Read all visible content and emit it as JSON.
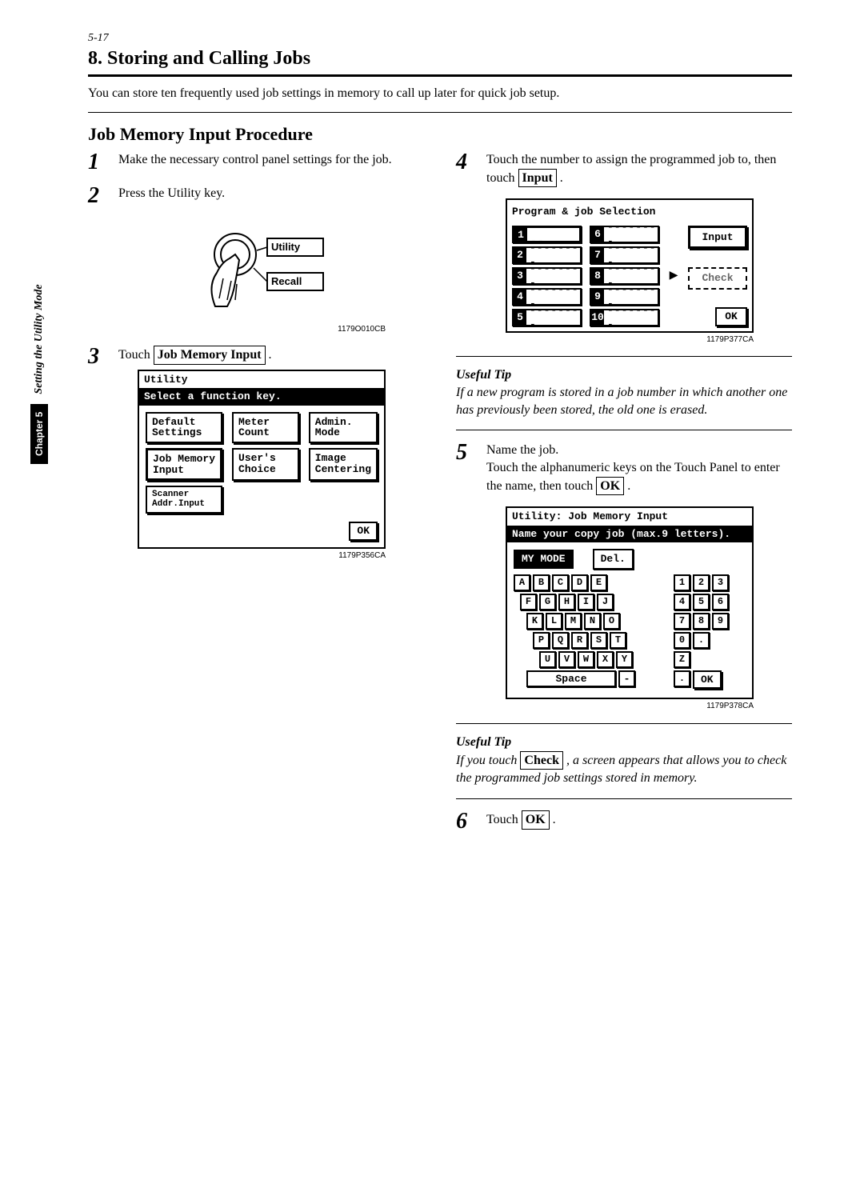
{
  "page_ref": "5-17",
  "section_number": "8.",
  "section_title": "Storing and Calling Jobs",
  "intro": "You can store ten frequently used job settings in memory to call up later for quick job setup.",
  "subsection_title": "Job Memory Input Procedure",
  "side_tab": {
    "chapter_pill": "Chapter 5",
    "label": "Setting the Utility Mode"
  },
  "left": {
    "step1": {
      "num": "1",
      "text": "Make the necessary control panel settings for the job."
    },
    "step2": {
      "num": "2",
      "text": "Press the Utility key.",
      "illus": {
        "utility": "Utility",
        "recall": "Recall"
      },
      "caption": "1179O010CB"
    },
    "step3": {
      "num": "3",
      "text_before": "Touch ",
      "button": "Job Memory Input",
      "text_after": " .",
      "panel": {
        "title": "Utility",
        "subtitle": "Select a function key.",
        "keys": [
          "Default\nSettings",
          "Meter\nCount",
          "Admin.\nMode",
          "Job Memory\nInput",
          "User's\nChoice",
          "Image\nCentering",
          "Scanner\nAddr.Input"
        ],
        "active_index": 3,
        "ok": "OK"
      },
      "caption": "1179P356CA"
    }
  },
  "right": {
    "step4": {
      "num": "4",
      "text_before": "Touch the number to assign the programmed job to, then touch ",
      "button": "Input",
      "text_after": " .",
      "panel": {
        "title": "Program & job Selection",
        "slots_left": [
          "1",
          "2",
          "3",
          "4",
          "5"
        ],
        "slots_right": [
          "6",
          "7",
          "8",
          "9",
          "10"
        ],
        "selected_slot": "1",
        "dashes": "--------",
        "input": "Input",
        "check": "Check",
        "ok": "OK"
      },
      "caption": "1179P377CA"
    },
    "tip1": {
      "title": "Useful Tip",
      "body": "If a new program is stored in a job number in which another one has previously been stored, the old one is erased."
    },
    "step5": {
      "num": "5",
      "line1": "Name the job.",
      "line2_before": "Touch the alphanumeric keys on the Touch Panel to enter the name, then touch ",
      "line2_button": "OK",
      "line2_after": " .",
      "panel": {
        "title": "Utility: Job Memory Input",
        "subtitle": "Name your copy job (max.9 letters).",
        "display": "MY MODE",
        "del": "Del.",
        "rows": [
          [
            "A",
            "B",
            "C",
            "D",
            "E"
          ],
          [
            "F",
            "G",
            "H",
            "I",
            "J"
          ],
          [
            "K",
            "L",
            "M",
            "N",
            "O"
          ],
          [
            "P",
            "Q",
            "R",
            "S",
            "T"
          ],
          [
            "U",
            "V",
            "W",
            "X",
            "Y"
          ]
        ],
        "num_rows": [
          [
            "1",
            "2",
            "3"
          ],
          [
            "4",
            "5",
            "6"
          ],
          [
            "7",
            "8",
            "9"
          ],
          [
            "0",
            "."
          ]
        ],
        "extra": {
          "z": "Z",
          "space": "Space",
          "dash": "-",
          "dot": "."
        },
        "ok": "OK"
      },
      "caption": "1179P378CA"
    },
    "tip2": {
      "title": "Useful Tip",
      "body_before": "If you touch ",
      "body_button": "Check",
      "body_after": " , a screen appears that allows you to check the programmed job settings stored in memory."
    },
    "step6": {
      "num": "6",
      "text_before": "Touch ",
      "button": "OK",
      "text_after": " ."
    }
  },
  "chart_data": null
}
